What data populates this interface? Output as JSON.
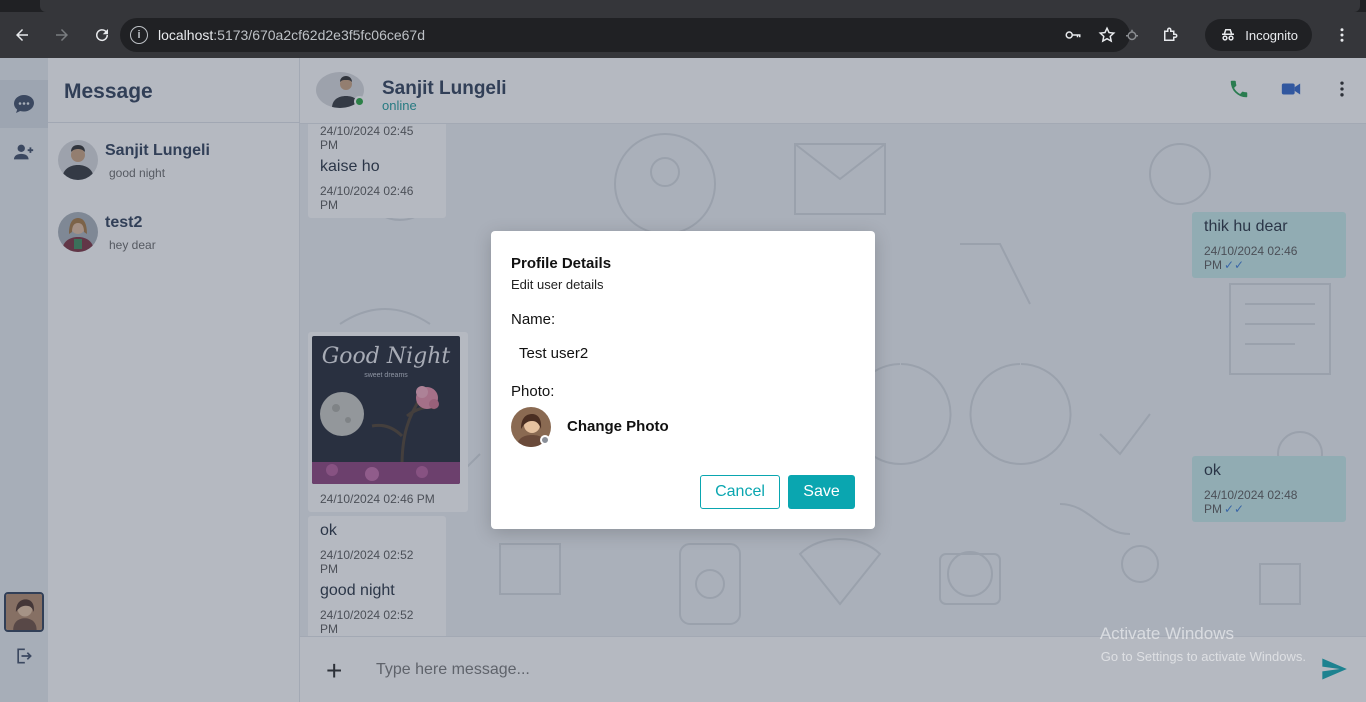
{
  "browser": {
    "url_host": "localhost",
    "url_path": ":5173/670a2cf62d2e3f5fc06ce67d",
    "profile_label": "Incognito"
  },
  "sidebar": {
    "title": "Message",
    "conversations": [
      {
        "name": "Sanjit Lungeli",
        "last": "good night"
      },
      {
        "name": "test2",
        "last": "hey dear"
      }
    ]
  },
  "chat": {
    "contact_name": "Sanjit Lungeli",
    "contact_status": "online",
    "messages": [
      {
        "from": "them",
        "text": "",
        "time": "24/10/2024 02:45 PM"
      },
      {
        "from": "them",
        "text": "kaise ho",
        "time": "24/10/2024 02:46 PM"
      },
      {
        "from": "me",
        "text": "thik hu dear",
        "time": "24/10/2024 02:46 PM"
      },
      {
        "from": "them",
        "image_title": "Good Night",
        "image_sub": "sweet dreams",
        "time": "24/10/2024 02:46 PM"
      },
      {
        "from": "me",
        "text": "ok",
        "time": "24/10/2024 02:48 PM"
      },
      {
        "from": "them",
        "text": "ok",
        "time": "24/10/2024 02:52 PM"
      },
      {
        "from": "them",
        "text": "good night",
        "time": "24/10/2024 02:52 PM"
      }
    ],
    "composer_placeholder": "Type here message...",
    "watermark_1": "Activate Windows",
    "watermark_2": "Go to Settings to activate Windows."
  },
  "modal": {
    "title": "Profile Details",
    "subtitle": "Edit user details",
    "name_label": "Name:",
    "name_value": "Test user2",
    "photo_label": "Photo:",
    "change_photo": "Change Photo",
    "cancel": "Cancel",
    "save": "Save"
  },
  "colors": {
    "accent": "#0aa6b0",
    "online": "#22a33a",
    "tick": "#3a7bd5",
    "call_icon": "#1f9d4a",
    "video_icon": "#2a62c9"
  }
}
